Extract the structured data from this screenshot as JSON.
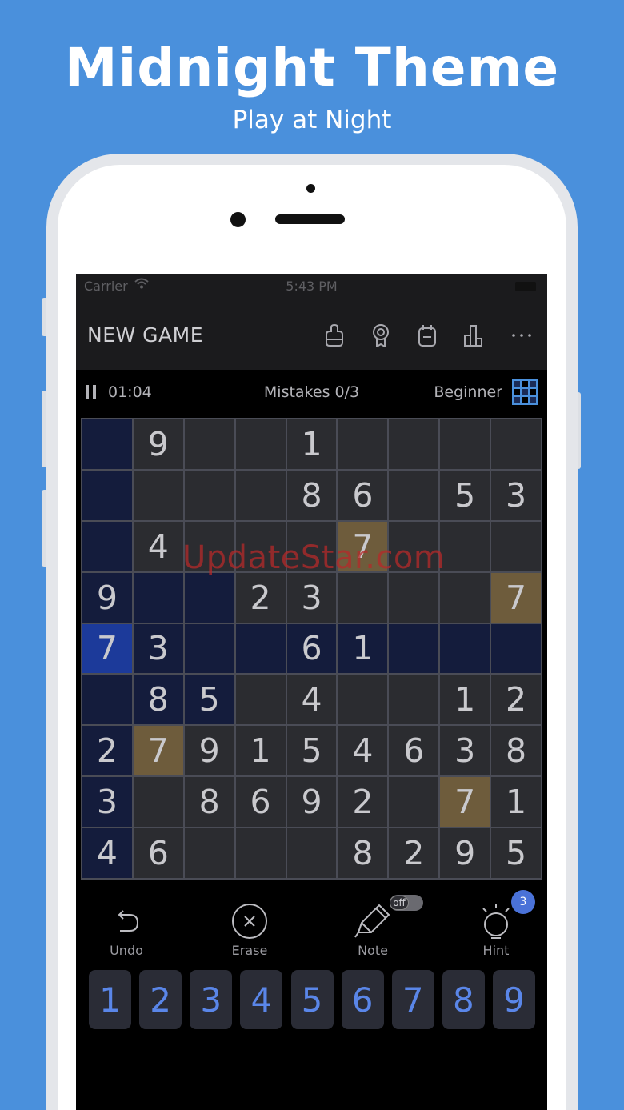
{
  "promo": {
    "title": "Midnight Theme",
    "subtitle": "Play at Night"
  },
  "status_bar": {
    "carrier": "Carrier",
    "time": "5:43 PM"
  },
  "nav": {
    "title": "NEW GAME",
    "icons": [
      "themes-icon",
      "awards-icon",
      "daily-challenge-icon",
      "statistics-icon",
      "more-icon"
    ]
  },
  "info": {
    "timer": "01:04",
    "mistakes": "Mistakes 0/3",
    "level": "Beginner"
  },
  "watermark": "UpdateStar.com",
  "board": {
    "cells": [
      [
        "",
        "9",
        "",
        "",
        "1",
        "",
        "",
        "",
        ""
      ],
      [
        "",
        "",
        "",
        "",
        "8",
        "6",
        "",
        "5",
        "3"
      ],
      [
        "",
        "4",
        "",
        "",
        "",
        "7",
        "",
        "",
        ""
      ],
      [
        "9",
        "",
        "",
        "2",
        "3",
        "",
        "",
        "",
        "7"
      ],
      [
        "7",
        "3",
        "",
        "",
        "6",
        "1",
        "",
        "",
        ""
      ],
      [
        "",
        "8",
        "5",
        "",
        "4",
        "",
        "",
        "1",
        "2"
      ],
      [
        "2",
        "7",
        "9",
        "1",
        "5",
        "4",
        "6",
        "3",
        "8"
      ],
      [
        "3",
        "",
        "8",
        "6",
        "9",
        "2",
        "",
        "7",
        "1"
      ],
      [
        "4",
        "6",
        "",
        "",
        "",
        "8",
        "2",
        "9",
        "5"
      ]
    ],
    "selected": [
      4,
      0
    ]
  },
  "tools": {
    "undo": "Undo",
    "erase": "Erase",
    "note": "Note",
    "note_toggle": "off",
    "hint": "Hint",
    "hint_count": "3"
  },
  "numpad": [
    "1",
    "2",
    "3",
    "4",
    "5",
    "6",
    "7",
    "8",
    "9"
  ],
  "colors": {
    "background": "#4a90dc",
    "selected_cell": "#1c3a9a",
    "highlight_cell": "#141c3c",
    "same_number_cell": "#6e5c3c",
    "numpad_digit": "#5a86e8"
  }
}
